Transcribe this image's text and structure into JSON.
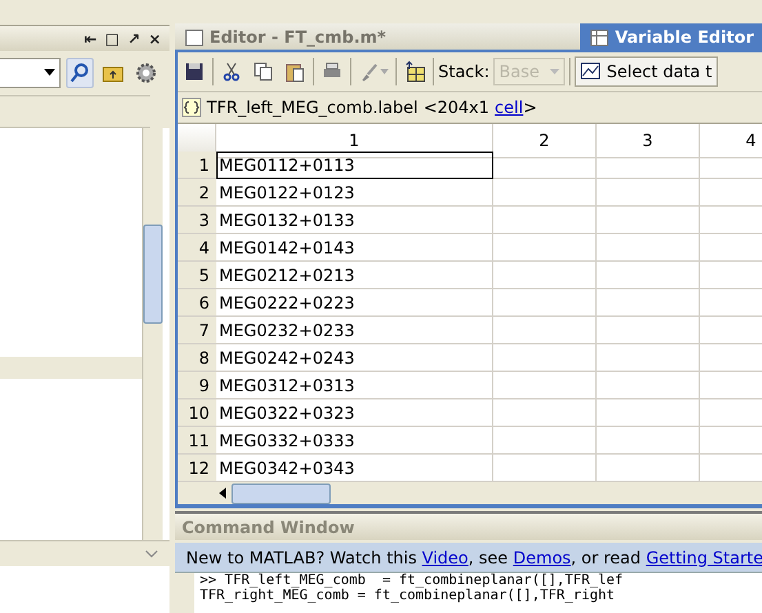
{
  "left_panel": {
    "title_buttons": [
      "⇤",
      "□",
      "↗",
      "×"
    ],
    "selected_row": true
  },
  "tabs": [
    {
      "label": "Editor - FT_cmb.m*",
      "selected": false
    },
    {
      "label": "Variable Editor",
      "selected": true
    }
  ],
  "toolbar": {
    "stack_label": "Stack:",
    "stack_value": "Base",
    "select_label": "Select data t"
  },
  "variable": {
    "name": "TFR_left_MEG_comb.label",
    "size": "<204x1",
    "type_link": "cell",
    "close": ">"
  },
  "table": {
    "columns": [
      "1",
      "2",
      "3",
      "4"
    ],
    "rows": [
      {
        "index": "1",
        "value": "MEG0112+0113",
        "selected": true
      },
      {
        "index": "2",
        "value": "MEG0122+0123",
        "selected": false
      },
      {
        "index": "3",
        "value": "MEG0132+0133",
        "selected": false
      },
      {
        "index": "4",
        "value": "MEG0142+0143",
        "selected": false
      },
      {
        "index": "5",
        "value": "MEG0212+0213",
        "selected": false
      },
      {
        "index": "6",
        "value": "MEG0222+0223",
        "selected": false
      },
      {
        "index": "7",
        "value": "MEG0232+0233",
        "selected": false
      },
      {
        "index": "8",
        "value": "MEG0242+0243",
        "selected": false
      },
      {
        "index": "9",
        "value": "MEG0312+0313",
        "selected": false
      },
      {
        "index": "10",
        "value": "MEG0322+0323",
        "selected": false
      },
      {
        "index": "11",
        "value": "MEG0332+0333",
        "selected": false
      },
      {
        "index": "12",
        "value": "MEG0342+0343",
        "selected": false
      }
    ]
  },
  "command_window": {
    "title": "Command Window",
    "info": [
      {
        "text": "New to MATLAB? Watch this ",
        "link": false
      },
      {
        "text": "Video",
        "link": true
      },
      {
        "text": ", see ",
        "link": false
      },
      {
        "text": "Demos",
        "link": true
      },
      {
        "text": ", or read ",
        "link": false
      },
      {
        "text": "Getting Starte",
        "link": true
      }
    ],
    "lines": [
      ">> TFR_left_MEG_comb  = ft_combineplanar([],TFR_lef",
      "TFR_right_MEG_comb = ft_combineplanar([],TFR_right"
    ]
  }
}
